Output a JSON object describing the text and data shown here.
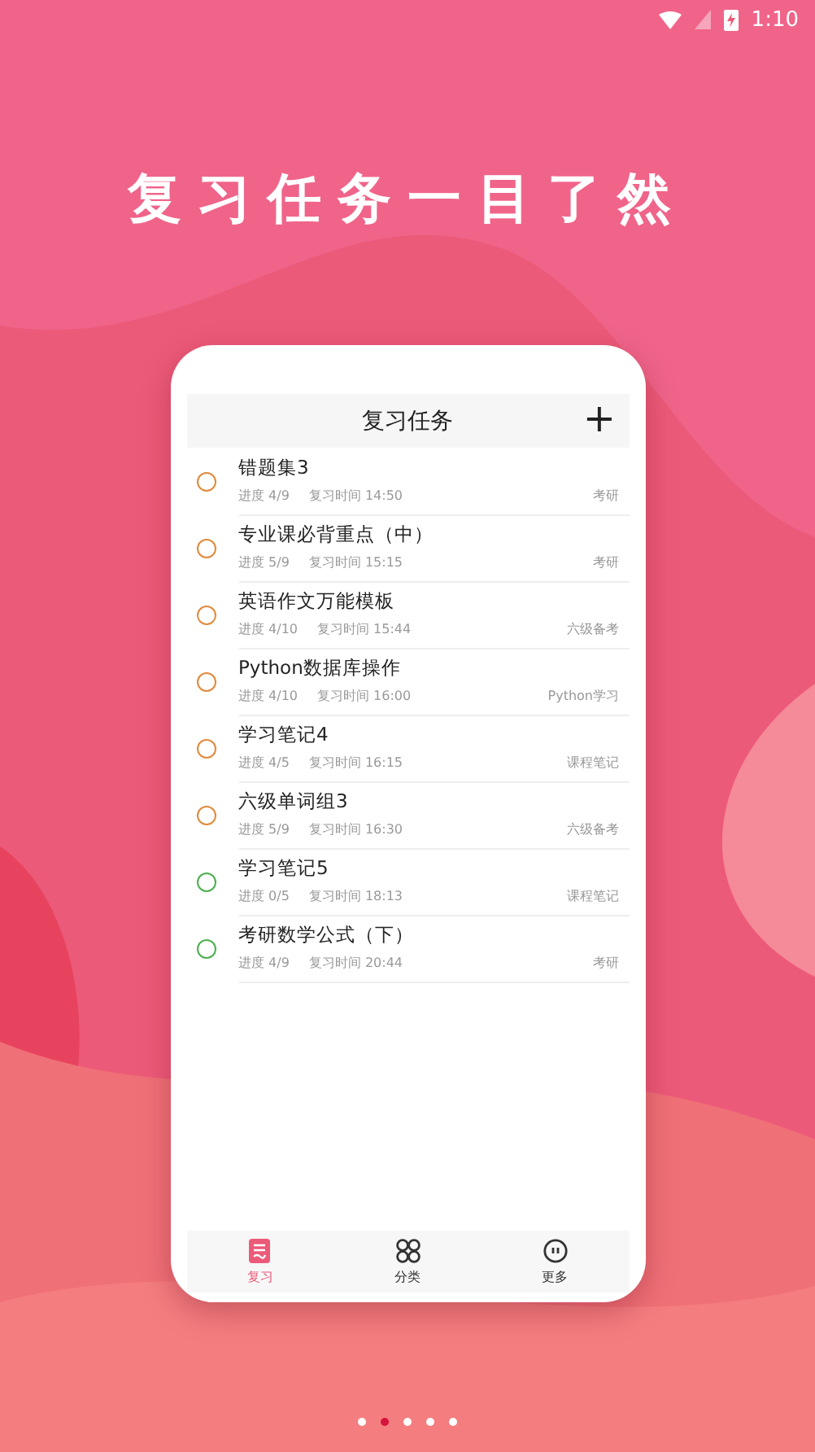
{
  "status_bar": {
    "time": "1:10"
  },
  "headline": "复习任务一目了然",
  "phone": {
    "title": "复习任务",
    "add_button": "+",
    "tasks": [
      {
        "title": "错题集3",
        "count": "进度 4/9",
        "time": "复习时间 14:50",
        "category": "考研",
        "color": "#e08a3c"
      },
      {
        "title": "专业课必背重点（中）",
        "count": "进度 5/9",
        "time": "复习时间 15:15",
        "category": "考研",
        "color": "#e08a3c"
      },
      {
        "title": "英语作文万能模板",
        "count": "进度 4/10",
        "time": "复习时间 15:44",
        "category": "六级备考",
        "color": "#e08a3c"
      },
      {
        "title": "Python数据库操作",
        "count": "进度 4/10",
        "time": "复习时间 16:00",
        "category": "Python学习",
        "color": "#e08a3c"
      },
      {
        "title": "学习笔记4",
        "count": "进度 4/5",
        "time": "复习时间 16:15",
        "category": "课程笔记",
        "color": "#e08a3c"
      },
      {
        "title": "六级单词组3",
        "count": "进度 5/9",
        "time": "复习时间 16:30",
        "category": "六级备考",
        "color": "#e08a3c"
      },
      {
        "title": "学习笔记5",
        "count": "进度 0/5",
        "time": "复习时间 18:13",
        "category": "课程笔记",
        "color": "#4caf50"
      },
      {
        "title": "考研数学公式（下）",
        "count": "进度 4/9",
        "time": "复习时间 20:44",
        "category": "考研",
        "color": "#4caf50"
      }
    ],
    "tabs": [
      {
        "label": "复习",
        "kind": "review",
        "selected": true
      },
      {
        "label": "分类",
        "kind": "category",
        "selected": false
      },
      {
        "label": "更多",
        "kind": "more",
        "selected": false
      }
    ]
  },
  "pager": [
    {
      "selected": false
    },
    {
      "selected": true
    },
    {
      "selected": false
    },
    {
      "selected": false
    },
    {
      "selected": false
    }
  ]
}
